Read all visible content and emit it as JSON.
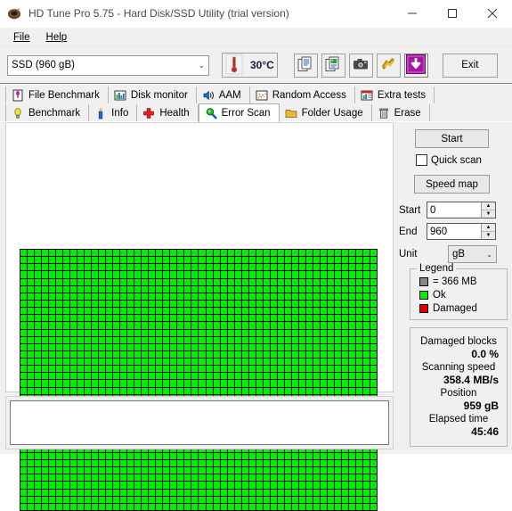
{
  "window": {
    "title": "HD Tune Pro 5.75 - Hard Disk/SSD Utility (trial version)",
    "icon": "hdd-platter-icon",
    "minimize_label": "—",
    "maximize_label": "☐",
    "close_label": "✕"
  },
  "menu": {
    "items": [
      {
        "label": "File",
        "accel": "F"
      },
      {
        "label": "Help",
        "accel": "H"
      }
    ]
  },
  "toolbar": {
    "drive_selected": "SSD (960 gB)",
    "drive_caret": "⌄",
    "temperature": "30°C",
    "temp_icon": "thermometer-icon",
    "buttons": [
      {
        "name": "copy-text-button",
        "icon": "copy-document-icon"
      },
      {
        "name": "copy-image-button",
        "icon": "copy-image-icon"
      },
      {
        "name": "screenshot-button",
        "icon": "camera-icon"
      },
      {
        "name": "settings-button",
        "icon": "options-icon"
      },
      {
        "name": "save-button",
        "icon": "download-arrow-icon"
      }
    ],
    "exit_label": "Exit"
  },
  "tabs": {
    "row1": [
      {
        "label": "File Benchmark",
        "icon": "file-benchmark-icon",
        "active": false
      },
      {
        "label": "Disk monitor",
        "icon": "bar-chart-icon",
        "active": false
      },
      {
        "label": "AAM",
        "icon": "speaker-icon",
        "active": false
      },
      {
        "label": "Random Access",
        "icon": "scatter-icon",
        "active": false
      },
      {
        "label": "Extra tests",
        "icon": "extra-chart-icon",
        "active": false
      }
    ],
    "row2": [
      {
        "label": "Benchmark",
        "icon": "lightbulb-icon",
        "active": false
      },
      {
        "label": "Info",
        "icon": "info-icon",
        "active": false
      },
      {
        "label": "Health",
        "icon": "red-cross-icon",
        "active": false
      },
      {
        "label": "Error Scan",
        "icon": "magnifier-icon",
        "active": true
      },
      {
        "label": "Folder Usage",
        "icon": "folder-icon",
        "active": false
      },
      {
        "label": "Erase",
        "icon": "trash-icon",
        "active": false
      }
    ]
  },
  "scan": {
    "start_button": "Start",
    "quick_scan_label": "Quick scan",
    "quick_scan_checked": false,
    "speed_map_button": "Speed map",
    "start_label": "Start",
    "start_value": "0",
    "end_label": "End",
    "end_value": "960",
    "unit_label": "Unit",
    "unit_value": "gB",
    "unit_caret": "⌄",
    "spinner_up": "▲",
    "spinner_down": "▼"
  },
  "legend": {
    "title": "Legend",
    "block_size": "= 366 MB",
    "ok_label": "Ok",
    "damaged_label": "Damaged",
    "color_ok": "#00ee00",
    "color_damaged": "#e00000",
    "color_block": "#888888"
  },
  "stats": {
    "damaged_blocks_label": "Damaged blocks",
    "damaged_blocks_value": "0.0 %",
    "scanning_speed_label": "Scanning speed",
    "scanning_speed_value": "358.4 MB/s",
    "position_label": "Position",
    "position_value": "959 gB",
    "elapsed_time_label": "Elapsed time",
    "elapsed_time_value": "45:46"
  },
  "grid": {
    "columns": 50,
    "rows": 36,
    "cell_color": "#00ee00",
    "border_color": "#000000",
    "log_text": ""
  }
}
